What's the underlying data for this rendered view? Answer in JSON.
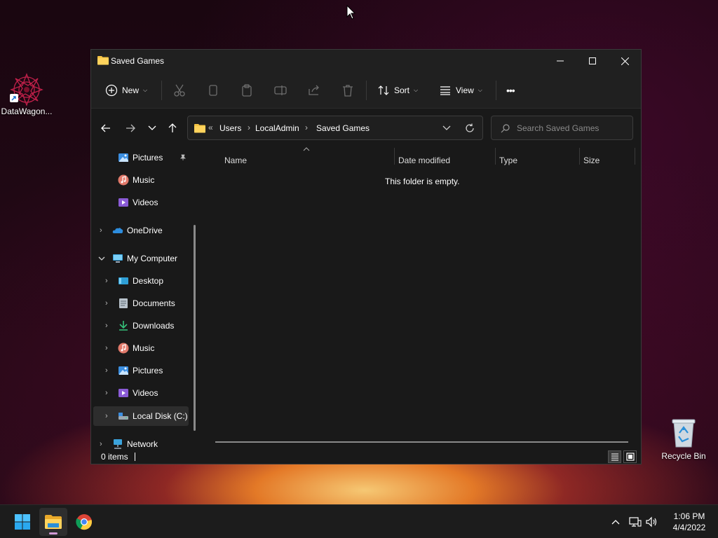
{
  "desktop": {
    "icons": [
      {
        "label": "DataWagon...",
        "icon": "datawagon-app-icon"
      },
      {
        "label": "Recycle Bin",
        "icon": "recycle-bin-icon"
      }
    ]
  },
  "window": {
    "title": "Saved Games",
    "controls": [
      "minimize",
      "maximize",
      "close"
    ]
  },
  "toolbar": {
    "new_label": "New",
    "sort_label": "Sort",
    "view_label": "View",
    "more_label": "•••",
    "icons": [
      "cut-icon",
      "copy-icon",
      "paste-icon",
      "rename-icon",
      "share-icon",
      "delete-icon"
    ]
  },
  "navigation": {
    "breadcrumb_overflow": "«",
    "breadcrumb": [
      "Users",
      "LocalAdmin",
      "Saved Games"
    ],
    "search_placeholder": "Search Saved Games"
  },
  "navpane": {
    "items": [
      {
        "label": "Pictures",
        "icon": "pictures-icon",
        "pinned": true
      },
      {
        "label": "Music",
        "icon": "music-icon"
      },
      {
        "label": "Videos",
        "icon": "videos-icon"
      },
      {
        "label": "OneDrive",
        "icon": "onedrive-icon",
        "expand": "collapsed"
      },
      {
        "label": "My Computer",
        "icon": "computer-icon",
        "expand": "expanded"
      },
      {
        "label": "Desktop",
        "icon": "desktop-icon",
        "expand": "collapsed"
      },
      {
        "label": "Documents",
        "icon": "documents-icon",
        "expand": "collapsed"
      },
      {
        "label": "Downloads",
        "icon": "downloads-icon",
        "expand": "collapsed"
      },
      {
        "label": "Music",
        "icon": "music-icon",
        "expand": "collapsed"
      },
      {
        "label": "Pictures",
        "icon": "pictures-icon",
        "expand": "collapsed"
      },
      {
        "label": "Videos",
        "icon": "videos-icon",
        "expand": "collapsed"
      },
      {
        "label": "Local Disk (C:)",
        "icon": "drive-icon",
        "expand": "collapsed",
        "selected": true
      },
      {
        "label": "Network",
        "icon": "network-icon",
        "expand": "collapsed"
      }
    ]
  },
  "content": {
    "columns": [
      "Name",
      "Date modified",
      "Type",
      "Size"
    ],
    "empty_message": "This folder is empty."
  },
  "status": {
    "item_count": "0 items"
  },
  "taskbar": {
    "apps": [
      "start-icon",
      "file-explorer-icon",
      "chrome-icon"
    ],
    "tray_icons": [
      "chevron-up-icon",
      "network-icon",
      "volume-icon"
    ],
    "time": "1:06 PM",
    "date": "4/4/2022"
  },
  "colors": {
    "window_bg": "#191919",
    "toolbar_bg": "#202020",
    "accent_folder": "#f4c344",
    "onedrive_blue": "#2d8dde"
  }
}
